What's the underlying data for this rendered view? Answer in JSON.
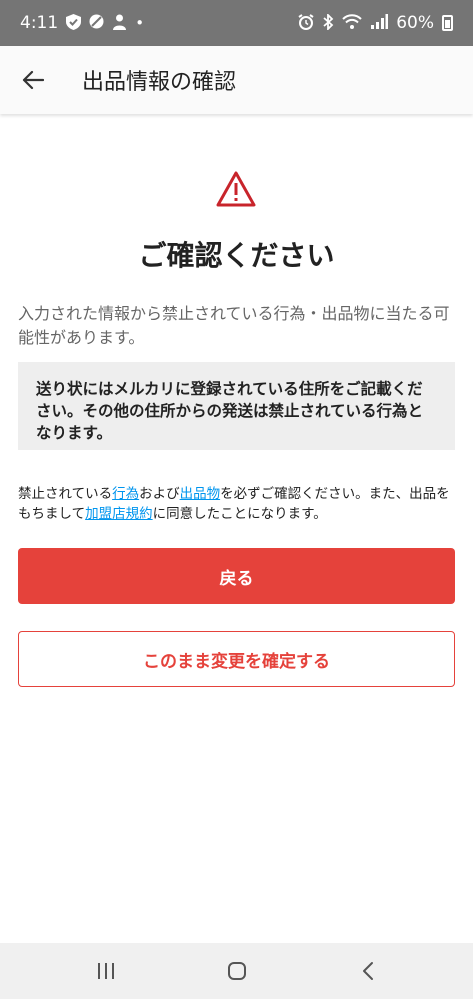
{
  "status_bar": {
    "time": "4:11",
    "battery": "60%",
    "icons": [
      "shield-check-icon",
      "do-not-disturb-icon",
      "person-icon",
      "dot-icon",
      "alarm-icon",
      "bluetooth-icon",
      "wifi-icon",
      "signal-icon",
      "battery-icon"
    ]
  },
  "app_bar": {
    "title": "出品情報の確認",
    "back_icon": "arrow-left-icon"
  },
  "content": {
    "heading": "ご確認ください",
    "intro": "入力された情報から禁止されている行為・出品物に当たる可能性があります。",
    "notice": "送り状にはメルカリに登録されている住所をご記載ください。その他の住所からの発送は禁止されている行為となります。",
    "terms": {
      "part1": "禁止されている",
      "link1": "行為",
      "part2": "および",
      "link2": "出品物",
      "part3": "を必ずご確認ください。また、出品をもちまして",
      "link3": "加盟店規約",
      "part4": "に同意したことになります。"
    }
  },
  "buttons": {
    "back": "戻る",
    "confirm": "このまま変更を確定する"
  },
  "colors": {
    "accent": "#e5423b",
    "link": "#0095ee",
    "notice_bg": "#eeeeee"
  },
  "nav_bar": {
    "icons": [
      "recent-apps-icon",
      "home-icon",
      "back-icon"
    ]
  }
}
